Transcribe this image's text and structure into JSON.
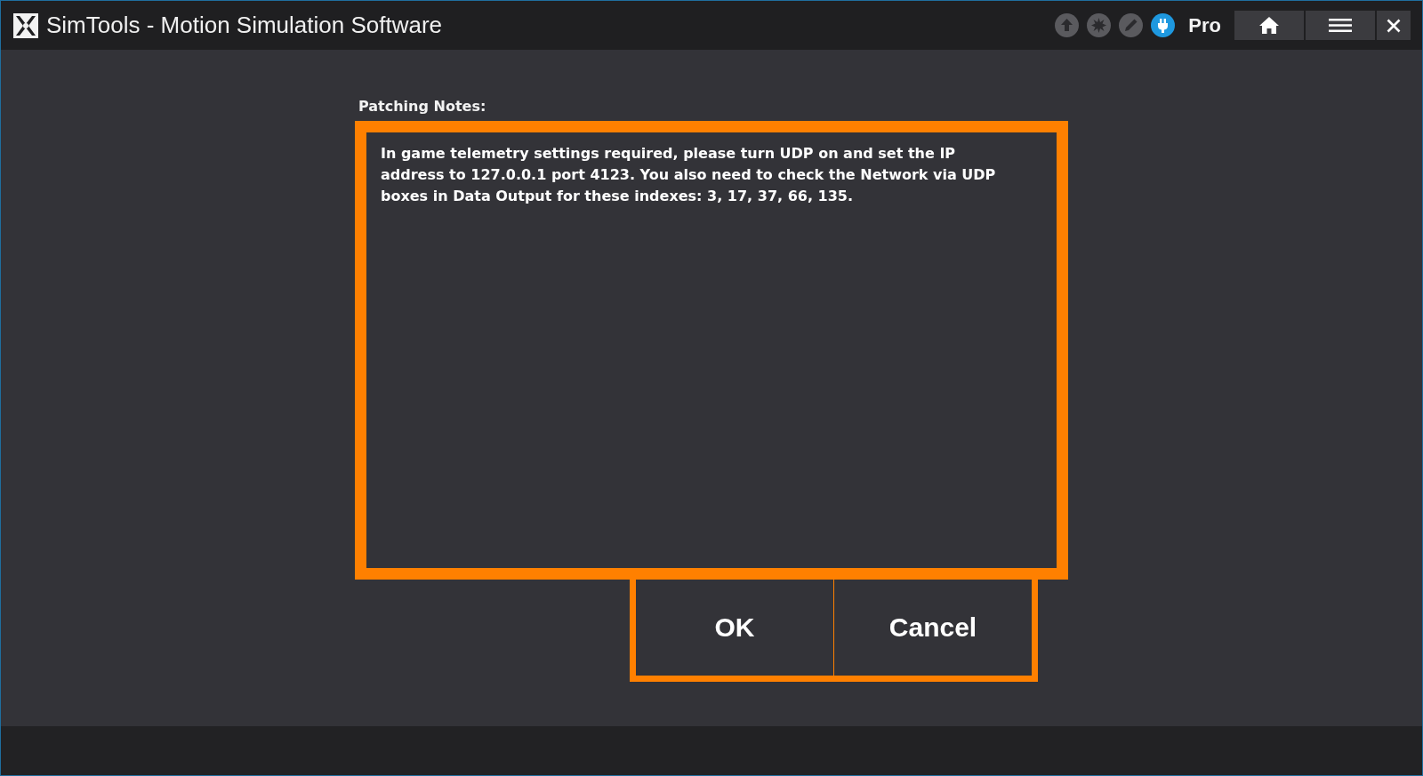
{
  "window": {
    "title": "SimTools - Motion Simulation Software"
  },
  "toolbar": {
    "status_icons": [
      {
        "active": false
      },
      {
        "active": false
      },
      {
        "active": false
      },
      {
        "active": true
      }
    ],
    "edition": "Pro"
  },
  "dialog": {
    "label": "Patching Notes:",
    "notes": "In game telemetry settings required, please turn UDP on and set the IP address to 127.0.0.1 port 4123. You also need to check the Network via UDP boxes in Data Output for these indexes: 3, 17, 37, 66, 135.",
    "buttons": [
      "OK",
      "Cancel"
    ]
  }
}
